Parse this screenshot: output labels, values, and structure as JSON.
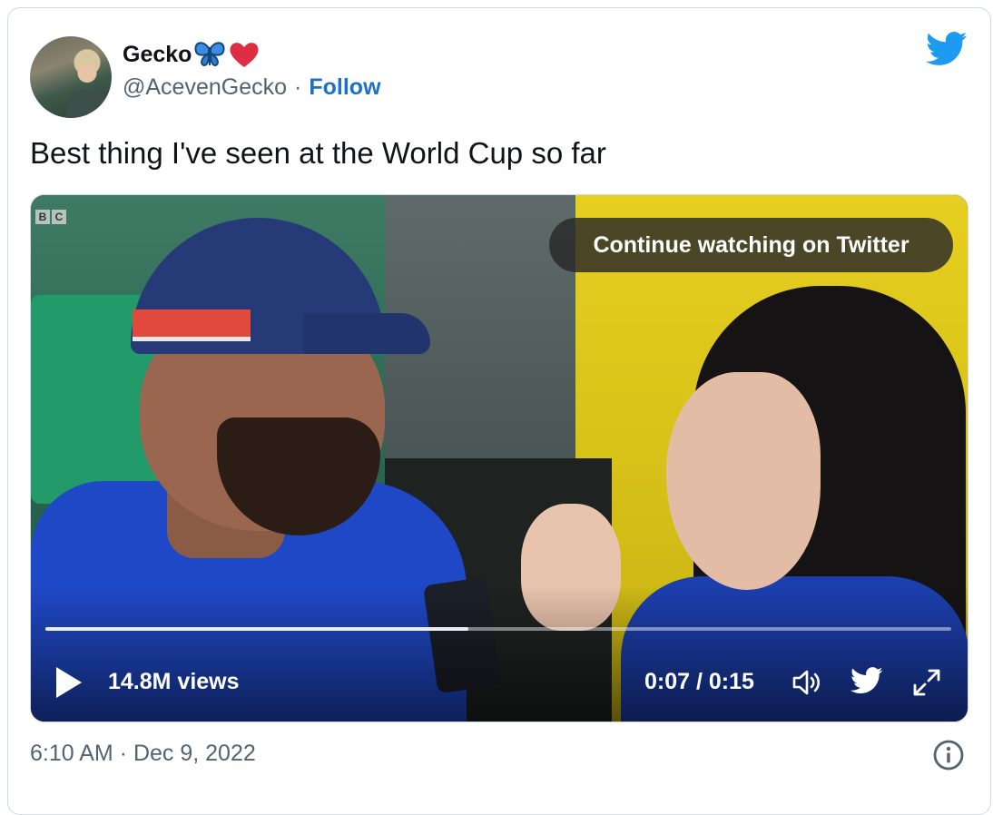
{
  "user": {
    "name": "Gecko",
    "handle": "@AcevenGecko",
    "separator": "·",
    "follow_label": "Follow"
  },
  "tweet": {
    "text": "Best thing I've seen at the World Cup so far",
    "timestamp": "6:10 AM · Dec 9, 2022"
  },
  "video": {
    "broadcaster": [
      "B",
      "C"
    ],
    "continue_label": "Continue watching on Twitter",
    "views": "14.8M views",
    "time": "0:07 / 0:15",
    "progress": 0.467
  },
  "colors": {
    "twitter_blue": "#1d9bf0",
    "follow": "#1d72c7",
    "muted": "#536471",
    "border": "#cfd9de"
  },
  "icons": [
    "butterfly-emoji-icon",
    "red-heart-emoji-icon",
    "twitter-bird-icon",
    "play-icon",
    "volume-icon",
    "twitter-small-icon",
    "fullscreen-icon",
    "info-icon"
  ]
}
